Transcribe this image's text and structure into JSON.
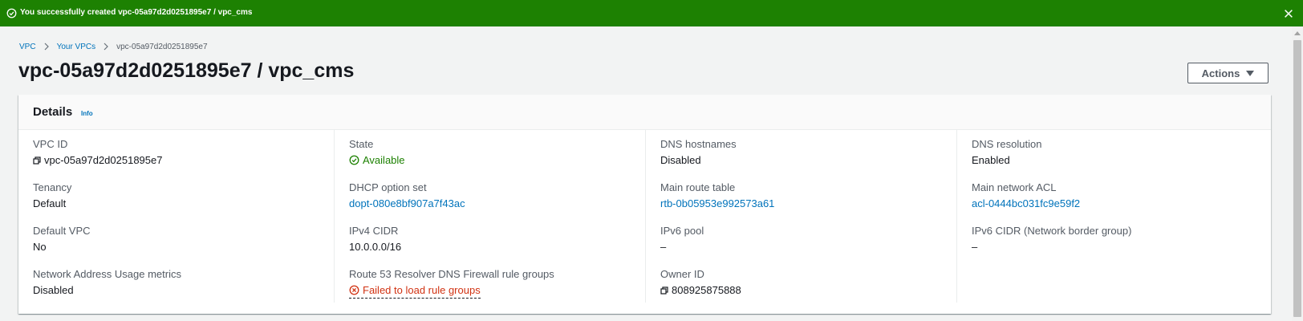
{
  "flash": {
    "message": "You successfully created vpc-05a97d2d0251895e7 / vpc_cms"
  },
  "breadcrumb": {
    "items": [
      "VPC",
      "Your VPCs",
      "vpc-05a97d2d0251895e7"
    ]
  },
  "page": {
    "title": "vpc-05a97d2d0251895e7 / vpc_cms",
    "actions_label": "Actions"
  },
  "details": {
    "title": "Details",
    "info": "Info",
    "col1": [
      {
        "label": "VPC ID",
        "value": "vpc-05a97d2d0251895e7"
      },
      {
        "label": "Tenancy",
        "value": "Default"
      },
      {
        "label": "Default VPC",
        "value": "No"
      },
      {
        "label": "Network Address Usage metrics",
        "value": "Disabled"
      }
    ],
    "col2": [
      {
        "label": "State",
        "value": "Available"
      },
      {
        "label": "DHCP option set",
        "value": "dopt-080e8bf907a7f43ac"
      },
      {
        "label": "IPv4 CIDR",
        "value": "10.0.0.0/16"
      },
      {
        "label": "Route 53 Resolver DNS Firewall rule groups",
        "value": "Failed to load rule groups"
      }
    ],
    "col3": [
      {
        "label": "DNS hostnames",
        "value": "Disabled"
      },
      {
        "label": "Main route table",
        "value": "rtb-0b05953e992573a61"
      },
      {
        "label": "IPv6 pool",
        "value": "–"
      },
      {
        "label": "Owner ID",
        "value": "808925875888"
      }
    ],
    "col4": [
      {
        "label": "DNS resolution",
        "value": "Enabled"
      },
      {
        "label": "Main network ACL",
        "value": "acl-0444bc031fc9e59f2"
      },
      {
        "label": "IPv6 CIDR (Network border group)",
        "value": "–"
      }
    ]
  },
  "colors": {
    "success": "#1d8102",
    "link": "#0073bb",
    "error": "#d13212"
  }
}
